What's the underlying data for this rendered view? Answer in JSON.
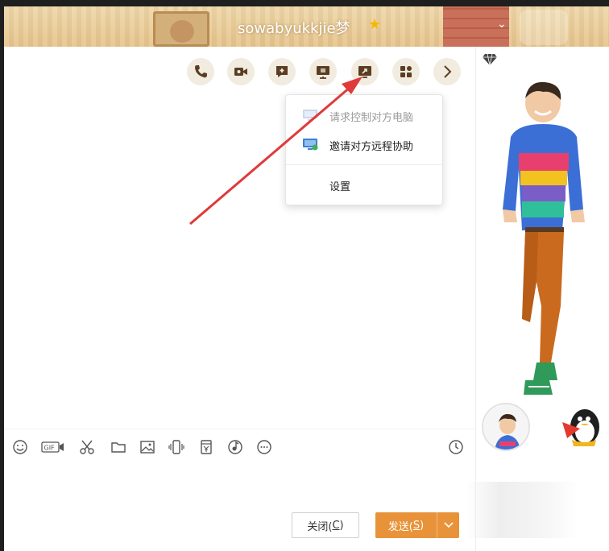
{
  "window": {
    "title": "sowabyukkjie梦",
    "title_badge": "star-icon"
  },
  "toolbar_top": {
    "icons": [
      "phone-icon",
      "video-call-icon",
      "chat-bubble-plus-icon",
      "screen-share-icon",
      "remote-desktop-icon",
      "apps-icon",
      "chevron-right-icon"
    ]
  },
  "remote_menu": {
    "items": [
      {
        "label": "请求控制对方电脑",
        "enabled": false
      },
      {
        "label": "邀请对方远程协助",
        "enabled": true
      },
      {
        "label": "设置",
        "enabled": true
      }
    ]
  },
  "input_toolbar": {
    "icons": [
      "emoji-icon",
      "gif-icon",
      "scissors-icon",
      "folder-icon",
      "image-icon",
      "shake-icon",
      "red-packet-icon",
      "music-icon",
      "more-icon"
    ],
    "history_icon": "clock-icon"
  },
  "buttons": {
    "close_label": "关闭(",
    "close_key": "C",
    "close_end": ")",
    "send_label": "发送(",
    "send_key": "S",
    "send_end": ")"
  },
  "colors": {
    "accent": "#e8933a",
    "arrow": "#e03a3a",
    "titlebar": "#e6c48c"
  }
}
